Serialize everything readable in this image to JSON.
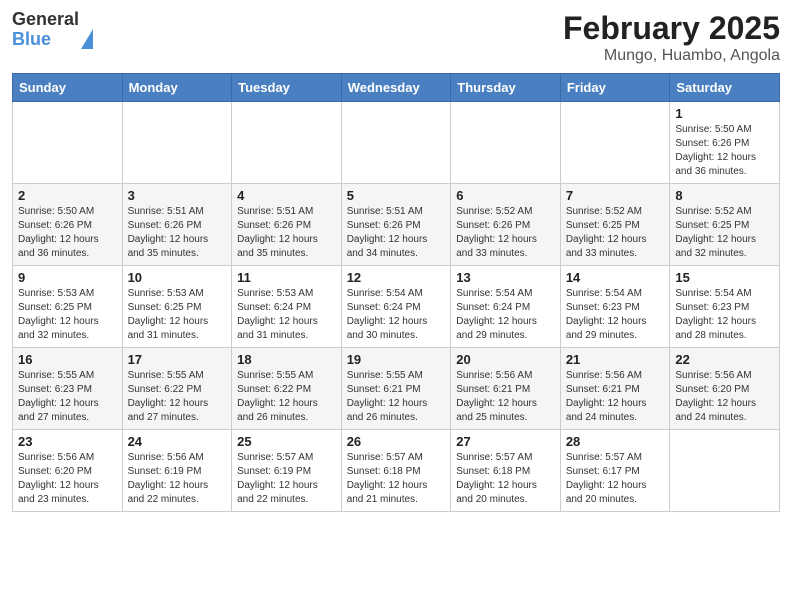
{
  "header": {
    "logo_line1": "General",
    "logo_line2": "Blue",
    "title": "February 2025",
    "subtitle": "Mungo, Huambo, Angola"
  },
  "calendar": {
    "days_of_week": [
      "Sunday",
      "Monday",
      "Tuesday",
      "Wednesday",
      "Thursday",
      "Friday",
      "Saturday"
    ],
    "weeks": [
      [
        {
          "num": "",
          "info": ""
        },
        {
          "num": "",
          "info": ""
        },
        {
          "num": "",
          "info": ""
        },
        {
          "num": "",
          "info": ""
        },
        {
          "num": "",
          "info": ""
        },
        {
          "num": "",
          "info": ""
        },
        {
          "num": "1",
          "info": "Sunrise: 5:50 AM\nSunset: 6:26 PM\nDaylight: 12 hours and 36 minutes."
        }
      ],
      [
        {
          "num": "2",
          "info": "Sunrise: 5:50 AM\nSunset: 6:26 PM\nDaylight: 12 hours and 36 minutes."
        },
        {
          "num": "3",
          "info": "Sunrise: 5:51 AM\nSunset: 6:26 PM\nDaylight: 12 hours and 35 minutes."
        },
        {
          "num": "4",
          "info": "Sunrise: 5:51 AM\nSunset: 6:26 PM\nDaylight: 12 hours and 35 minutes."
        },
        {
          "num": "5",
          "info": "Sunrise: 5:51 AM\nSunset: 6:26 PM\nDaylight: 12 hours and 34 minutes."
        },
        {
          "num": "6",
          "info": "Sunrise: 5:52 AM\nSunset: 6:26 PM\nDaylight: 12 hours and 33 minutes."
        },
        {
          "num": "7",
          "info": "Sunrise: 5:52 AM\nSunset: 6:25 PM\nDaylight: 12 hours and 33 minutes."
        },
        {
          "num": "8",
          "info": "Sunrise: 5:52 AM\nSunset: 6:25 PM\nDaylight: 12 hours and 32 minutes."
        }
      ],
      [
        {
          "num": "9",
          "info": "Sunrise: 5:53 AM\nSunset: 6:25 PM\nDaylight: 12 hours and 32 minutes."
        },
        {
          "num": "10",
          "info": "Sunrise: 5:53 AM\nSunset: 6:25 PM\nDaylight: 12 hours and 31 minutes."
        },
        {
          "num": "11",
          "info": "Sunrise: 5:53 AM\nSunset: 6:24 PM\nDaylight: 12 hours and 31 minutes."
        },
        {
          "num": "12",
          "info": "Sunrise: 5:54 AM\nSunset: 6:24 PM\nDaylight: 12 hours and 30 minutes."
        },
        {
          "num": "13",
          "info": "Sunrise: 5:54 AM\nSunset: 6:24 PM\nDaylight: 12 hours and 29 minutes."
        },
        {
          "num": "14",
          "info": "Sunrise: 5:54 AM\nSunset: 6:23 PM\nDaylight: 12 hours and 29 minutes."
        },
        {
          "num": "15",
          "info": "Sunrise: 5:54 AM\nSunset: 6:23 PM\nDaylight: 12 hours and 28 minutes."
        }
      ],
      [
        {
          "num": "16",
          "info": "Sunrise: 5:55 AM\nSunset: 6:23 PM\nDaylight: 12 hours and 27 minutes."
        },
        {
          "num": "17",
          "info": "Sunrise: 5:55 AM\nSunset: 6:22 PM\nDaylight: 12 hours and 27 minutes."
        },
        {
          "num": "18",
          "info": "Sunrise: 5:55 AM\nSunset: 6:22 PM\nDaylight: 12 hours and 26 minutes."
        },
        {
          "num": "19",
          "info": "Sunrise: 5:55 AM\nSunset: 6:21 PM\nDaylight: 12 hours and 26 minutes."
        },
        {
          "num": "20",
          "info": "Sunrise: 5:56 AM\nSunset: 6:21 PM\nDaylight: 12 hours and 25 minutes."
        },
        {
          "num": "21",
          "info": "Sunrise: 5:56 AM\nSunset: 6:21 PM\nDaylight: 12 hours and 24 minutes."
        },
        {
          "num": "22",
          "info": "Sunrise: 5:56 AM\nSunset: 6:20 PM\nDaylight: 12 hours and 24 minutes."
        }
      ],
      [
        {
          "num": "23",
          "info": "Sunrise: 5:56 AM\nSunset: 6:20 PM\nDaylight: 12 hours and 23 minutes."
        },
        {
          "num": "24",
          "info": "Sunrise: 5:56 AM\nSunset: 6:19 PM\nDaylight: 12 hours and 22 minutes."
        },
        {
          "num": "25",
          "info": "Sunrise: 5:57 AM\nSunset: 6:19 PM\nDaylight: 12 hours and 22 minutes."
        },
        {
          "num": "26",
          "info": "Sunrise: 5:57 AM\nSunset: 6:18 PM\nDaylight: 12 hours and 21 minutes."
        },
        {
          "num": "27",
          "info": "Sunrise: 5:57 AM\nSunset: 6:18 PM\nDaylight: 12 hours and 20 minutes."
        },
        {
          "num": "28",
          "info": "Sunrise: 5:57 AM\nSunset: 6:17 PM\nDaylight: 12 hours and 20 minutes."
        },
        {
          "num": "",
          "info": ""
        }
      ]
    ]
  }
}
